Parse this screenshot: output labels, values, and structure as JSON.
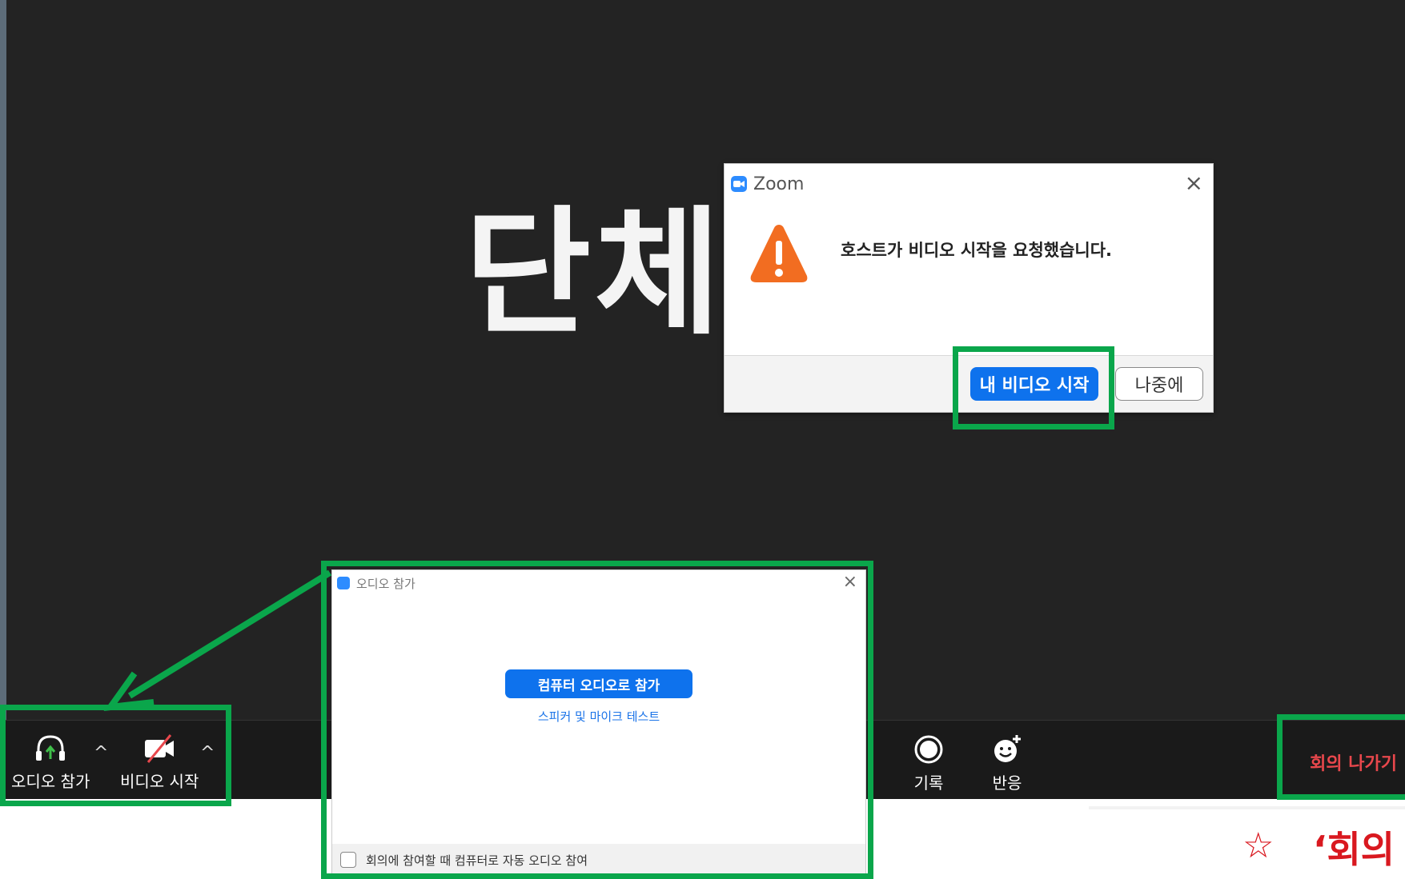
{
  "meeting": {
    "display_name": "단체명"
  },
  "dialog": {
    "title": "Zoom",
    "message": "호스트가 비디오 시작을 요청했습니다.",
    "primary_button": "내 비디오 시작",
    "secondary_button": "나중에",
    "close_glyph": "×"
  },
  "toolbar": {
    "audio_label": "오디오 참가",
    "video_label": "비디오 시작",
    "record_label": "기록",
    "reactions_label": "반응",
    "leave_label": "회의 나가기",
    "caret_glyph": "^"
  },
  "audio_panel": {
    "title": "오디오 참가",
    "join_button": "컴퓨터 오디오로 참가",
    "test_link": "스피커 및 마이크 테스트",
    "auto_join_label": "회의에 참여할 때 컴퓨터로 자동 오디오 참여",
    "close_glyph": "×"
  },
  "note": {
    "star": "☆",
    "text": "‘회의"
  },
  "colors": {
    "highlight": "#0aa64b",
    "primary_blue": "#0e72ed",
    "leave_red": "#e8474c",
    "warning_orange": "#f26d21",
    "video_off_red": "#e8474c"
  },
  "icons": {
    "audio": "headphones-icon",
    "video": "video-off-icon",
    "record": "record-icon",
    "reactions": "reaction-icon",
    "warning": "warning-icon"
  }
}
